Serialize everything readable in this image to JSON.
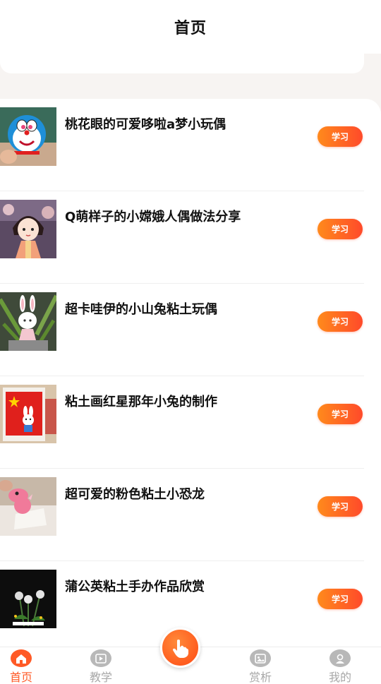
{
  "header": {
    "title": "首页"
  },
  "list": {
    "items": [
      {
        "title": "桃花眼的可爱哆啦a梦小玩偶",
        "button": "学习",
        "image": "doraemon-figure"
      },
      {
        "title": "Q萌样子的小嫦娥人偶做法分享",
        "button": "学习",
        "image": "change-doll"
      },
      {
        "title": "超卡哇伊的小山兔粘土玩偶",
        "button": "学习",
        "image": "bunny-figure"
      },
      {
        "title": "粘土画红星那年小兔的制作",
        "button": "学习",
        "image": "clay-painting-bunny"
      },
      {
        "title": "超可爱的粉色粘土小恐龙",
        "button": "学习",
        "image": "pink-dinosaur"
      },
      {
        "title": "蒲公英粘土手办作品欣赏",
        "button": "学习",
        "image": "dandelion-clay"
      }
    ]
  },
  "tabbar": {
    "tabs": [
      {
        "label": "首页",
        "icon": "home-icon",
        "active": true
      },
      {
        "label": "教学",
        "icon": "play-icon",
        "active": false
      },
      {
        "label": "赏析",
        "icon": "gallery-icon",
        "active": false
      },
      {
        "label": "我的",
        "icon": "profile-icon",
        "active": false
      }
    ],
    "center_icon": "hand-tap-icon"
  },
  "colors": {
    "accent": "#ff5a26",
    "button_gradient_start": "#ff8a1c",
    "button_gradient_end": "#ff4a2a",
    "inactive": "#a8a8a8"
  }
}
